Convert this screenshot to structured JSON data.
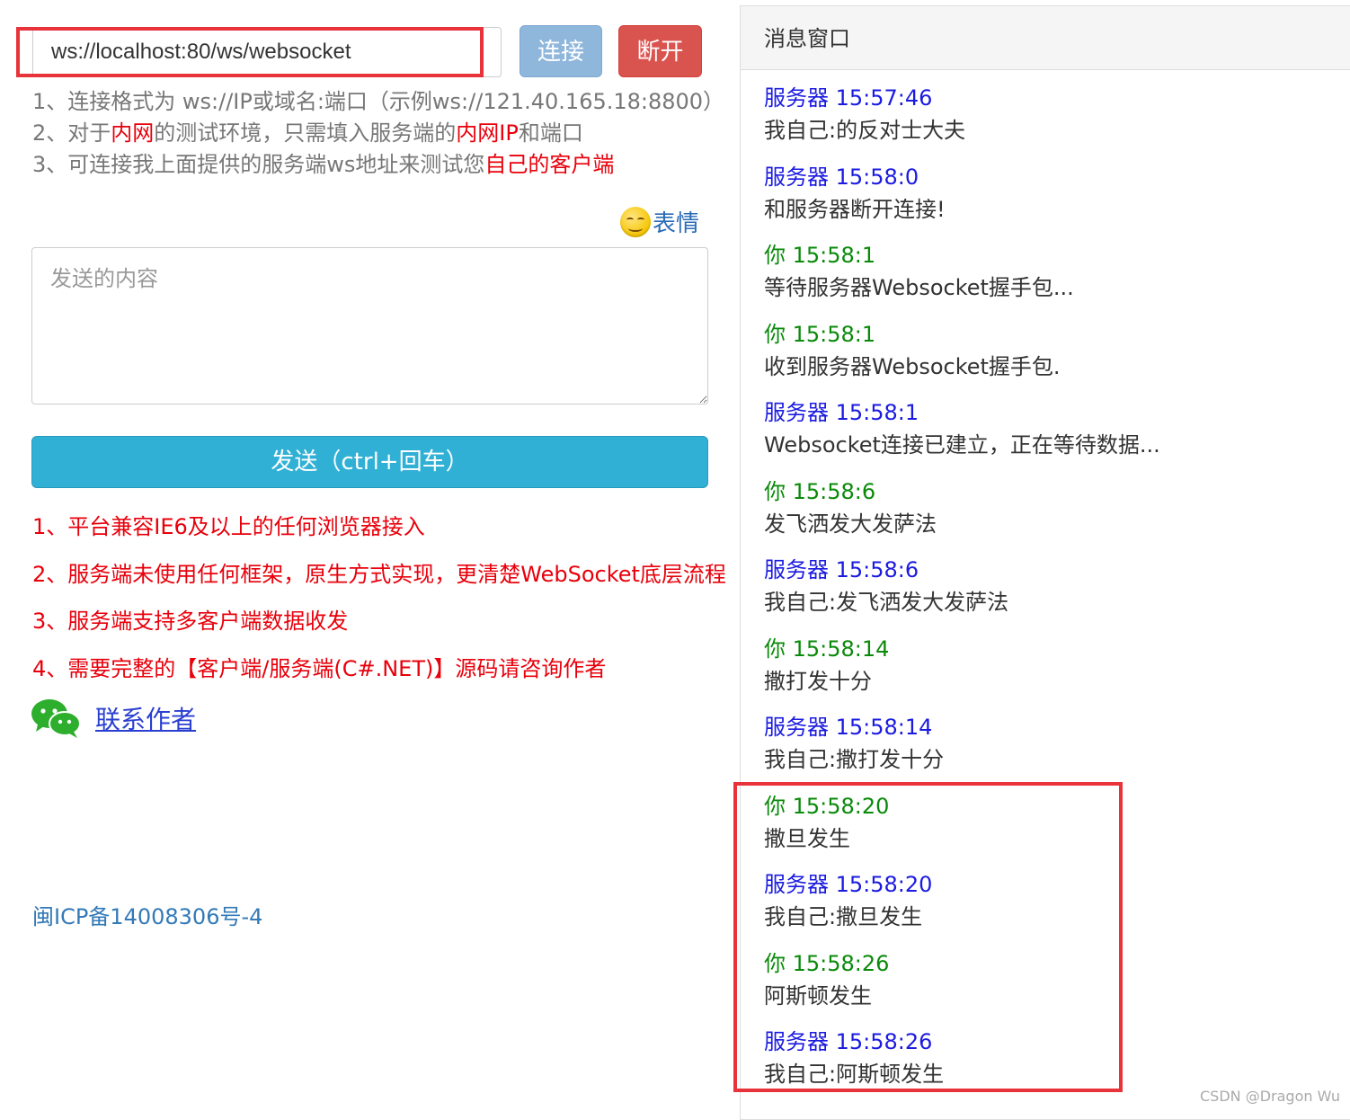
{
  "connection": {
    "url_value": "ws://localhost:80/ws/websocket",
    "connect_label": "连接",
    "disconnect_label": "断开"
  },
  "tips": {
    "line1": "1、连接格式为 ws://IP或域名:端口（示例ws://121.40.165.18:8800）",
    "line2_a": "2、对于",
    "line2_b": "内网",
    "line2_c": "的测试环境，只需填入服务端的",
    "line2_d": "内网IP",
    "line2_e": "和端口",
    "line3_a": "3、可连接我上面提供的服务端ws地址来测试您",
    "line3_b": "自己的客户端"
  },
  "emoji": {
    "icon": "smile-emoji-icon",
    "label": "表情"
  },
  "composer": {
    "placeholder": "发送的内容",
    "value": ""
  },
  "send_label": "发送（ctrl+回车）",
  "features": [
    "1、平台兼容IE6及以上的任何浏览器接入",
    "2、服务端未使用任何框架，原生方式实现，更清楚WebSocket底层流程",
    "3、服务端支持多客户端数据收发",
    "4、需要完整的【客户端/服务端(C#.NET)】源码请咨询作者"
  ],
  "contact": {
    "icon": "wechat-icon",
    "label": "联系作者"
  },
  "icp": "闽ICP备14008306号-4",
  "message_window": {
    "title": "消息窗口",
    "messages": [
      {
        "sender": "服务器",
        "time": "15:57:46",
        "text": "我自己:的反对士大夫",
        "kind": "server"
      },
      {
        "sender": "服务器",
        "time": "15:58:0",
        "text": "和服务器断开连接!",
        "kind": "server"
      },
      {
        "sender": "你",
        "time": "15:58:1",
        "text": "等待服务器Websocket握手包...",
        "kind": "you"
      },
      {
        "sender": "你",
        "time": "15:58:1",
        "text": "收到服务器Websocket握手包.",
        "kind": "you"
      },
      {
        "sender": "服务器",
        "time": "15:58:1",
        "text": "Websocket连接已建立，正在等待数据...",
        "kind": "server"
      },
      {
        "sender": "你",
        "time": "15:58:6",
        "text": "发飞洒发大发萨法",
        "kind": "you"
      },
      {
        "sender": "服务器",
        "time": "15:58:6",
        "text": "我自己:发飞洒发大发萨法",
        "kind": "server"
      },
      {
        "sender": "你",
        "time": "15:58:14",
        "text": "撒打发十分",
        "kind": "you"
      },
      {
        "sender": "服务器",
        "time": "15:58:14",
        "text": "我自己:撒打发十分",
        "kind": "server"
      },
      {
        "sender": "你",
        "time": "15:58:20",
        "text": "撒旦发生",
        "kind": "you"
      },
      {
        "sender": "服务器",
        "time": "15:58:20",
        "text": "我自己:撒旦发生",
        "kind": "server"
      },
      {
        "sender": "你",
        "time": "15:58:26",
        "text": "阿斯顿发生",
        "kind": "you"
      },
      {
        "sender": "服务器",
        "time": "15:58:26",
        "text": "我自己:阿斯顿发生",
        "kind": "server"
      }
    ]
  },
  "colors": {
    "highlight_border": "#e8333b",
    "connect_btn": "#8fb6db",
    "disconnect_btn": "#d9534f",
    "send_btn": "#31b0d5",
    "server_name": "#1b1be0",
    "you_name": "#0a8a0a",
    "red_text": "#e8000b",
    "link": "#337ab7"
  },
  "watermark": "CSDN @Dragon   Wu"
}
